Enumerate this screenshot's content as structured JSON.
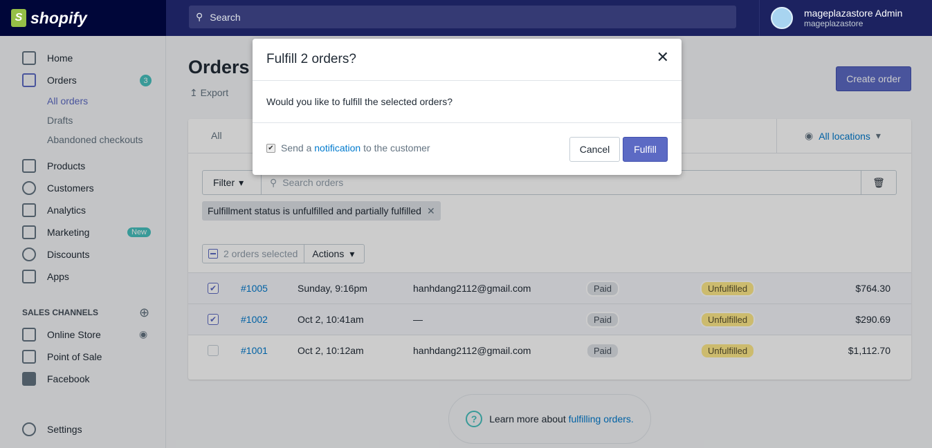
{
  "header": {
    "brand": "shopify",
    "search_placeholder": "Search",
    "user_name": "mageplazastore Admin",
    "store": "mageplazastore"
  },
  "sidebar": {
    "home": "Home",
    "orders": "Orders",
    "orders_badge": "3",
    "all_orders": "All orders",
    "drafts": "Drafts",
    "abandoned": "Abandoned checkouts",
    "products": "Products",
    "customers": "Customers",
    "analytics": "Analytics",
    "marketing": "Marketing",
    "marketing_badge": "New",
    "discounts": "Discounts",
    "apps": "Apps",
    "sales_channels": "SALES CHANNELS",
    "online_store": "Online Store",
    "pos": "Point of Sale",
    "facebook": "Facebook",
    "settings": "Settings"
  },
  "page": {
    "title": "Orders",
    "export": "Export",
    "create_order": "Create order",
    "tab_all": "All",
    "locations": "All locations",
    "filter": "Filter",
    "search_placeholder": "Search orders",
    "filter_tag": "Fulfillment status is unfulfilled and partially fulfilled",
    "selected": "2 orders selected",
    "actions": "Actions"
  },
  "orders": [
    {
      "id": "#1005",
      "date": "Sunday, 9:16pm",
      "customer": "hanhdang2112@gmail.com",
      "payment": "Paid",
      "fulfillment": "Unfulfilled",
      "total": "$764.30",
      "checked": true
    },
    {
      "id": "#1002",
      "date": "Oct 2, 10:41am",
      "customer": "—",
      "payment": "Paid",
      "fulfillment": "Unfulfilled",
      "total": "$290.69",
      "checked": true
    },
    {
      "id": "#1001",
      "date": "Oct 2, 10:12am",
      "customer": "hanhdang2112@gmail.com",
      "payment": "Paid",
      "fulfillment": "Unfulfilled",
      "total": "$1,112.70",
      "checked": false
    }
  ],
  "learn": {
    "text": "Learn more about",
    "link": "fulfilling orders."
  },
  "modal": {
    "title": "Fulfill 2 orders?",
    "body": "Would you like to fulfill the selected orders?",
    "send_a": "Send a",
    "notification": "notification",
    "to_customer": "to the customer",
    "cancel": "Cancel",
    "fulfill": "Fulfill",
    "notify_checked": true
  }
}
